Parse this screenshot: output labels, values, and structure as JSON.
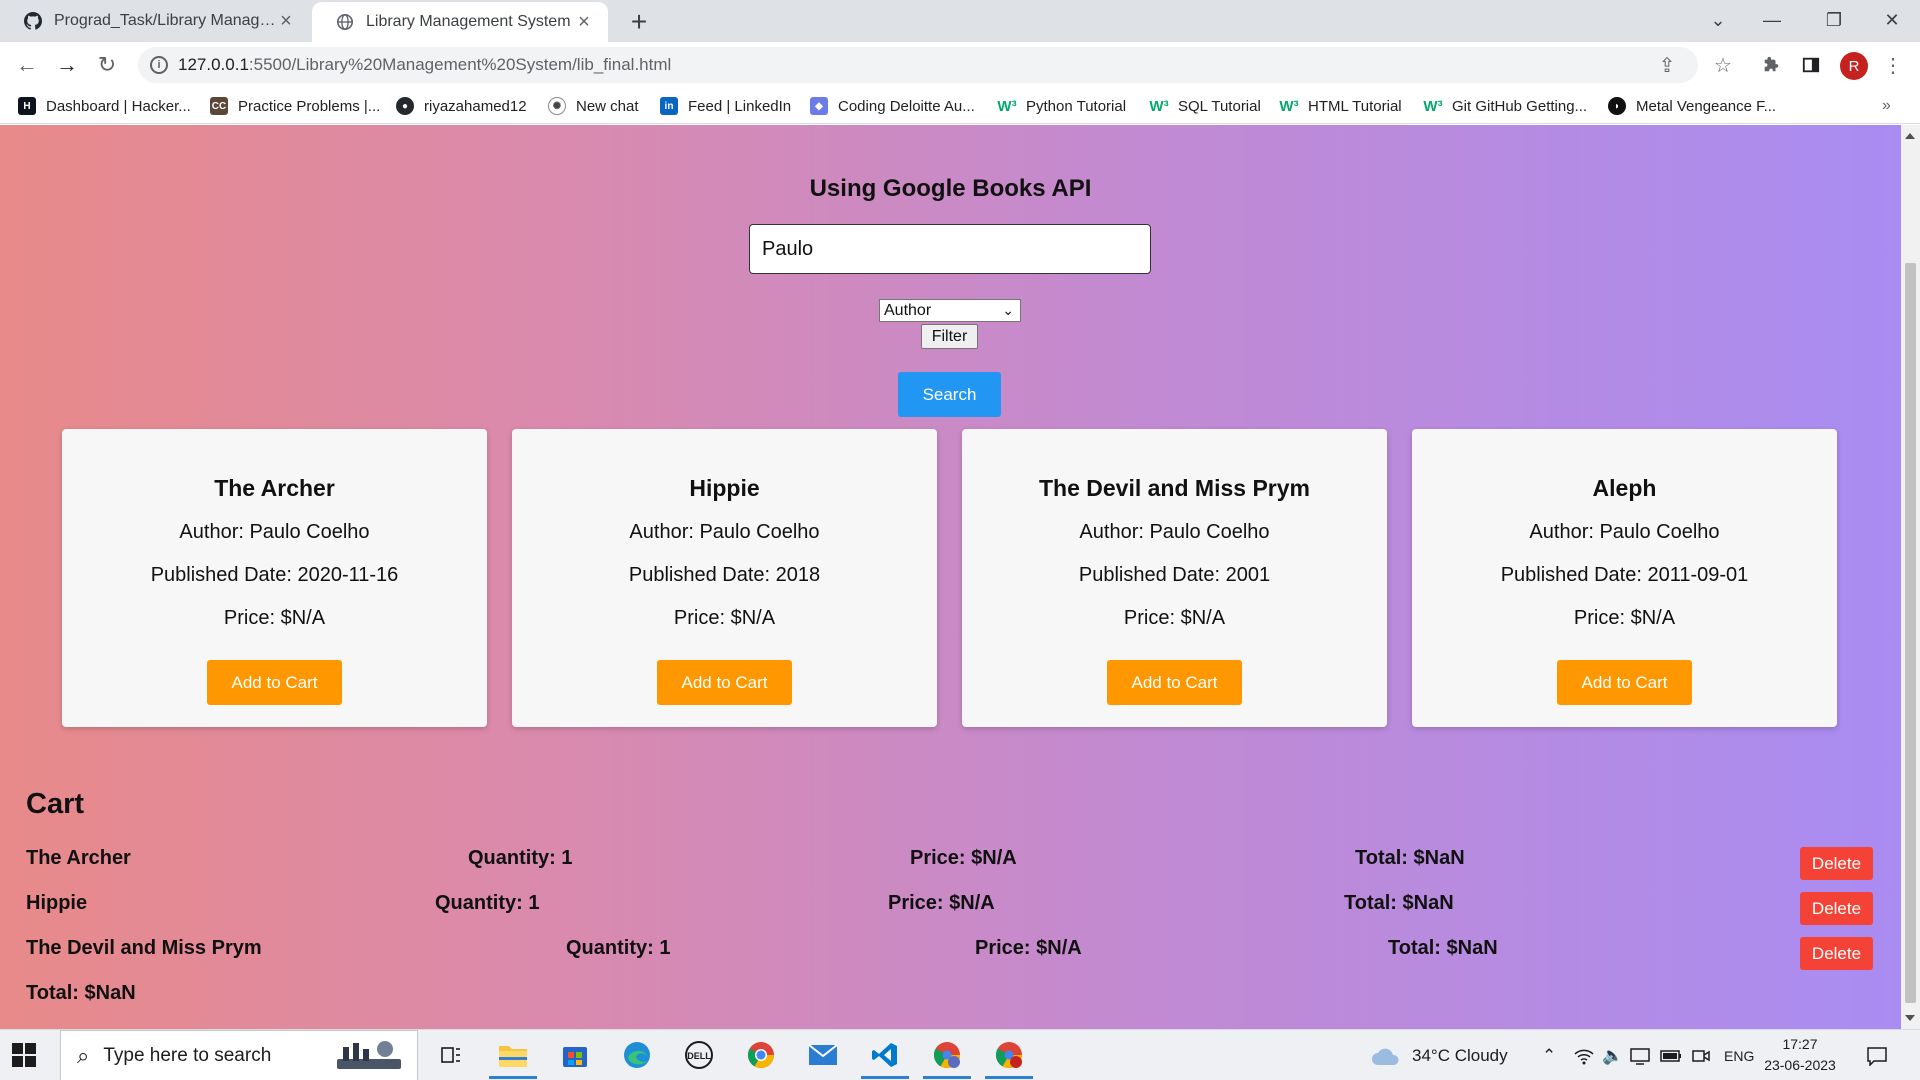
{
  "browser": {
    "tabs": [
      {
        "title": "Prograd_Task/Library Manageme",
        "active": false
      },
      {
        "title": "Library Management System",
        "active": true
      }
    ],
    "url_host": "127.0.0.1",
    "url_path": ":5500/Library%20Management%20System/lib_final.html",
    "bookmarks": [
      "Dashboard | Hacker...",
      "Practice Problems |...",
      "riyazahamed12",
      "New chat",
      "Feed | LinkedIn",
      "Coding Deloitte Au...",
      "Python Tutorial",
      "SQL Tutorial",
      "HTML Tutorial",
      "Git GitHub Getting...",
      "Metal Vengeance F..."
    ],
    "profile_initial": "R"
  },
  "page": {
    "heading": "Using Google Books API",
    "search_value": "Paulo",
    "filter_selected": "Author",
    "filter_button": "Filter",
    "search_button": "Search",
    "books": [
      {
        "title": "The Archer",
        "author": "Author: Paulo Coelho",
        "date": "Published Date: 2020-11-16",
        "price": "Price: $N/A",
        "button": "Add to Cart"
      },
      {
        "title": "Hippie",
        "author": "Author: Paulo Coelho",
        "date": "Published Date: 2018",
        "price": "Price: $N/A",
        "button": "Add to Cart"
      },
      {
        "title": "The Devil and Miss Prym",
        "author": "Author: Paulo Coelho",
        "date": "Published Date: 2001",
        "price": "Price: $N/A",
        "button": "Add to Cart"
      },
      {
        "title": "Aleph",
        "author": "Author: Paulo Coelho",
        "date": "Published Date: 2011-09-01",
        "price": "Price: $N/A",
        "button": "Add to Cart"
      }
    ],
    "cart": {
      "title": "Cart",
      "items": [
        {
          "title": "The Archer",
          "quantity": "Quantity: 1",
          "price": "Price: $N/A",
          "total": "Total: $NaN",
          "delete": "Delete"
        },
        {
          "title": "Hippie",
          "quantity": "Quantity: 1",
          "price": "Price: $N/A",
          "total": "Total: $NaN",
          "delete": "Delete"
        },
        {
          "title": "The Devil and Miss Prym",
          "quantity": "Quantity: 1",
          "price": "Price: $N/A",
          "total": "Total: $NaN",
          "delete": "Delete"
        }
      ],
      "grand_total": "Total: $NaN"
    }
  },
  "taskbar": {
    "search_placeholder": "Type here to search",
    "weather": "34°C  Cloudy",
    "language": "ENG",
    "time": "17:27",
    "date": "23-06-2023"
  },
  "colors": {
    "search_button": "#2196f3",
    "add_to_cart": "#ff9800",
    "delete": "#f44336",
    "gradient_left": "#e88a8a",
    "gradient_right": "#a98cf2"
  }
}
